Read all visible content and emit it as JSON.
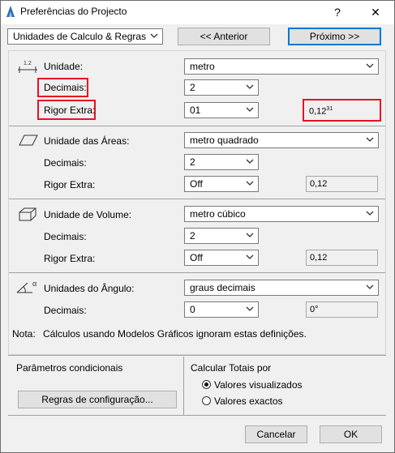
{
  "window": {
    "title": "Preferências do Projecto",
    "help": "?",
    "close": "✕"
  },
  "top": {
    "category": "Unidades de Calculo & Regras",
    "prev_button": "<< Anterior",
    "next_button": "Próximo >>"
  },
  "length": {
    "icon_label": "1.2",
    "label": "Unidade:",
    "unit": "metro",
    "decimals_label": "Decimais:",
    "decimals": "2",
    "extra_label": "Rigor Extra:",
    "extra": "01",
    "preview_main": "0,12",
    "preview_sup": "31"
  },
  "area": {
    "label": "Unidade das Áreas:",
    "unit": "metro quadrado",
    "decimals_label": "Decimais:",
    "decimals": "2",
    "extra_label": "Rigor Extra:",
    "extra": "Off",
    "preview": "0,12"
  },
  "volume": {
    "label": "Unidade de Volume:",
    "unit": "metro cúbico",
    "decimals_label": "Decimais:",
    "decimals": "2",
    "extra_label": "Rigor Extra:",
    "extra": "Off",
    "preview": "0,12"
  },
  "angle": {
    "icon_label": "α",
    "label": "Unidades do Ângulo:",
    "unit": "graus decimais",
    "decimals_label": "Decimais:",
    "decimals": "0",
    "preview": "0°"
  },
  "note": {
    "label": "Nota:",
    "text": "Cálculos usando Modelos Gráficos ignoram estas definições."
  },
  "conditional": {
    "title": "Parâmetros condicionais",
    "button": "Regras de configuração..."
  },
  "totals": {
    "title": "Calcular Totais por",
    "option_visual": "Valores visualizados",
    "option_exact": "Valores exactos",
    "selected": "Valores visualizados"
  },
  "footer": {
    "cancel": "Cancelar",
    "ok": "OK"
  },
  "colors": {
    "highlight": "#e81123",
    "focus": "#0078d7"
  }
}
